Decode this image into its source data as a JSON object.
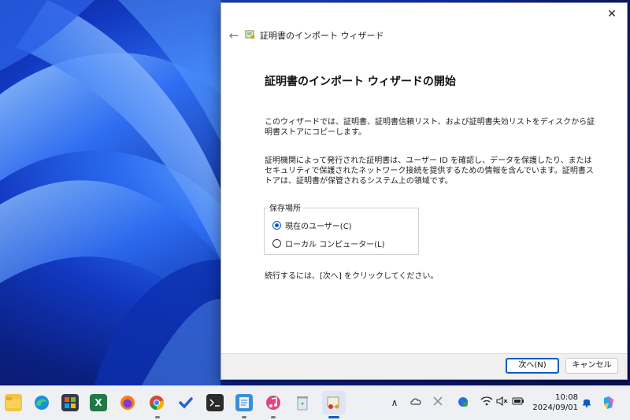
{
  "dialog": {
    "close_glyph": "✕",
    "back_glyph": "←",
    "wizard_title": "証明書のインポート ウィザード",
    "heading": "証明書のインポート ウィザードの開始",
    "paragraph1": "このウィザードでは、証明書、証明書信頼リスト、および証明書失効リストをディスクから証明書ストアにコピーします。",
    "paragraph2": "証明機関によって発行された証明書は、ユーザー ID を確認し、データを保護したり、またはセキュリティで保護されたネットワーク接続を提供するための情報を含んでいます。証明書ストアは、証明書が保管されるシステム上の領域です。",
    "store_location": {
      "legend": "保存場所",
      "options": [
        {
          "label": "現在のユーザー(C)",
          "selected": true
        },
        {
          "label": "ローカル コンピューター(L)",
          "selected": false
        }
      ]
    },
    "paragraph3": "続行するには、[次へ] をクリックしてください。",
    "buttons": {
      "next": "次へ(N)",
      "cancel": "キャンセル"
    },
    "accent_color": "#0a5bc4"
  },
  "taskbar": {
    "apps": [
      {
        "name": "file-explorer-icon"
      },
      {
        "name": "edge-icon"
      },
      {
        "name": "microsoft-store-icon"
      },
      {
        "name": "excel-icon"
      },
      {
        "name": "firefox-icon"
      },
      {
        "name": "chrome-icon"
      },
      {
        "name": "todo-icon"
      },
      {
        "name": "terminal-icon"
      },
      {
        "name": "notepad-icon"
      },
      {
        "name": "music-icon"
      },
      {
        "name": "recycle-bin-icon"
      },
      {
        "name": "certificate-wizard-icon"
      }
    ],
    "tray": {
      "chevron": "∧",
      "time": "10:08",
      "date": "2024/09/01"
    }
  }
}
